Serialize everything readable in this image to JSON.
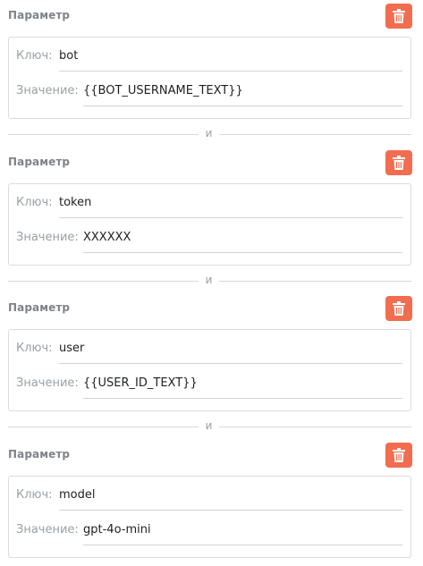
{
  "section_title": "Параметр",
  "key_label": "Ключ:",
  "value_label": "Значение:",
  "separator_label": "и",
  "delete_icon": "trash-icon",
  "colors": {
    "delete_button": "#f26d4f",
    "title_text": "#7f8389",
    "label_text": "#9aa0a6",
    "border": "#d9dcdf"
  },
  "params": [
    {
      "key": "bot",
      "value": "{{BOT_USERNAME_TEXT}}"
    },
    {
      "key": "token",
      "value": "XXXXXX"
    },
    {
      "key": "user",
      "value": "{{USER_ID_TEXT}}"
    },
    {
      "key": "model",
      "value": "gpt-4o-mini"
    }
  ]
}
